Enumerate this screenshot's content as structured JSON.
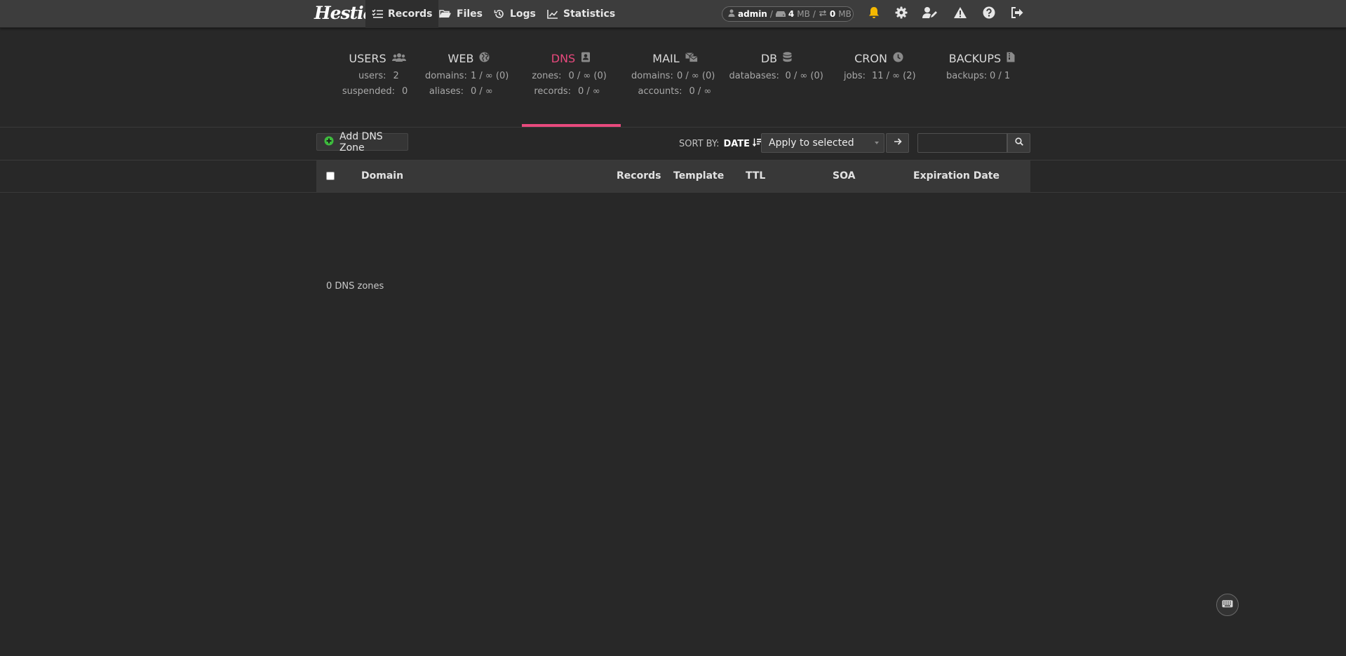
{
  "header": {
    "logo_text": "Hestia",
    "nav": [
      {
        "label": "Records",
        "icon": "list-check-icon",
        "active": true
      },
      {
        "label": "Files",
        "icon": "folder-open-icon"
      },
      {
        "label": "Logs",
        "icon": "history-icon"
      },
      {
        "label": "Statistics",
        "icon": "chart-line-icon"
      }
    ],
    "user": {
      "name": "admin",
      "sep1": "/",
      "disk_value": "4",
      "disk_unit": "MB",
      "sep2": "/",
      "bandwidth_value": "0",
      "bandwidth_unit": "MB"
    },
    "icons": [
      "bell-icon",
      "gear-icon",
      "user-edit-icon",
      "warning-icon",
      "help-icon",
      "logout-icon"
    ],
    "accent_color": "#e8497d",
    "bell_color": "#f5b800"
  },
  "stats": {
    "users": {
      "title": "USERS",
      "rows": [
        {
          "label": "users:",
          "value": "2"
        },
        {
          "label": "suspended:",
          "value": "0"
        }
      ]
    },
    "web": {
      "title": "WEB",
      "rows": [
        {
          "label": "domains:",
          "value": "1 / ∞ (0)"
        },
        {
          "label": "aliases:",
          "value": "0 / ∞"
        }
      ]
    },
    "dns": {
      "title": "DNS",
      "active": true,
      "rows": [
        {
          "label": "zones:",
          "value": "0 / ∞ (0)"
        },
        {
          "label": "records:",
          "value": "0 / ∞"
        }
      ]
    },
    "mail": {
      "title": "MAIL",
      "rows": [
        {
          "label": "domains:",
          "value": "0 / ∞ (0)"
        },
        {
          "label": "accounts:",
          "value": "0 / ∞"
        }
      ]
    },
    "db": {
      "title": "DB",
      "rows": [
        {
          "label": "databases:",
          "value": "0 / ∞ (0)"
        }
      ]
    },
    "cron": {
      "title": "CRON",
      "rows": [
        {
          "label": "jobs:",
          "value": "11 / ∞ (2)"
        }
      ]
    },
    "backups": {
      "title": "BACKUPS",
      "rows": [
        {
          "label": "backups:",
          "value": "0 / 1"
        }
      ]
    }
  },
  "toolbar": {
    "add_label": "Add DNS Zone",
    "sort_label": "SORT BY:",
    "sort_value": "DATE",
    "apply_label": "Apply to selected",
    "search_placeholder": ""
  },
  "table": {
    "columns": [
      "Domain",
      "Records",
      "Template",
      "TTL",
      "SOA",
      "Expiration Date"
    ]
  },
  "footer": {
    "count_text": "0 DNS zones"
  }
}
